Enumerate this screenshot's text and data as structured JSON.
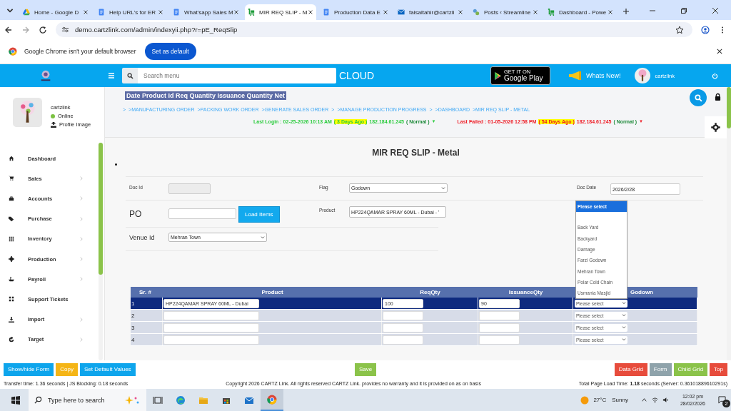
{
  "browser": {
    "tabs": [
      {
        "title": "Home - Google D",
        "selected": false
      },
      {
        "title": "Help URL's for ER",
        "selected": false
      },
      {
        "title": "What'sapp Sales M",
        "selected": false
      },
      {
        "title": "MIR REQ SLIP - M",
        "selected": true
      },
      {
        "title": "Production Data E",
        "selected": false
      },
      {
        "title": "faisaltahir@cartzli",
        "selected": false
      },
      {
        "title": "Posts ‹ Streamline",
        "selected": false
      },
      {
        "title": "Dashboard - Powe",
        "selected": false
      }
    ],
    "url": "demo.cartzlink.com/admin/indexyii.php?r=pE_ReqSlip",
    "infobar": {
      "message": "Google Chrome isn't your default browser",
      "button": "Set as default"
    }
  },
  "header": {
    "search_placeholder": "Search menu",
    "cloud": "CLOUD",
    "play_small": "GET IT ON",
    "play_big": "Google Play",
    "whats_new": "Whats New!",
    "user": "cartzlink"
  },
  "profile": {
    "name": "cartzlink",
    "status": "Online",
    "upload": "Profile Image"
  },
  "sidebar": {
    "items": [
      {
        "label": "Dashboard",
        "has_children": false
      },
      {
        "label": "Sales",
        "has_children": true
      },
      {
        "label": "Accounts",
        "has_children": true
      },
      {
        "label": "Purchase",
        "has_children": true
      },
      {
        "label": "Inventory",
        "has_children": true
      },
      {
        "label": "Production",
        "has_children": true
      },
      {
        "label": "Payroll",
        "has_children": true
      },
      {
        "label": "Support Tickets",
        "has_children": false
      },
      {
        "label": "Import",
        "has_children": true
      },
      {
        "label": "Target",
        "has_children": true
      }
    ]
  },
  "page": {
    "tooltip": "Date Product Id Req Quantity Issuance Quantity Net",
    "breadcrumbs": [
      ">",
      ">MANUFACTURING ORDER",
      ">PACKING WORK ORDER",
      ">GENERATE SALES ORDER",
      ">",
      ">MANAGE PRODUCTION PROGRESS",
      ">",
      ">DASHBOARD",
      ">MIR REQ SLIP - METAL"
    ],
    "logins": [
      {
        "color": "#2ecc40",
        "segments": [
          {
            "kind": "text",
            "text": "Last Login : 02-25-2026 10:13 AM"
          },
          {
            "kind": "highlight",
            "text": "( 3 Days Ago )"
          },
          {
            "kind": "text",
            "text": "182.184.61.245"
          },
          {
            "kind": "status",
            "text": "( Normal )"
          },
          {
            "kind": "arrow",
            "text": "▼"
          }
        ]
      },
      {
        "color": "#ee1c25",
        "segments": [
          {
            "kind": "text",
            "text": "Last Failed : 01-05-2026 12:58 PM"
          },
          {
            "kind": "highlight",
            "text": "( 54 Days Ago )"
          },
          {
            "kind": "text",
            "text": "182.184.61.245"
          },
          {
            "kind": "status",
            "text": "( Normal )"
          },
          {
            "kind": "arrow",
            "text": "▼"
          }
        ]
      }
    ],
    "form_title": "MIR REQ SLIP - Metal"
  },
  "form": {
    "doc_id_label": "Doc Id",
    "flag_label": "Flag",
    "flag_value": "Godown",
    "doc_date_label": "Doc Date",
    "doc_date": "2026/2/28",
    "po_label": "PO",
    "load_button": "Load Items",
    "product_label": "Product",
    "product_value": "HP224QAMAR SPRAY 60ML - Dubai - '",
    "venue_label": "Venue Id",
    "venue_value": "Mehran Town",
    "godown_menu": [
      {
        "label": "Please select",
        "selected": true
      },
      {
        "label": "Back Yard",
        "selected": false
      },
      {
        "label": "Backyard",
        "selected": false
      },
      {
        "label": "Damage",
        "selected": false
      },
      {
        "label": "Farzi Godown",
        "selected": false
      },
      {
        "label": "Mehran Town",
        "selected": false
      },
      {
        "label": "Polar Cold Chain",
        "selected": false
      },
      {
        "label": "Usmania Masjid",
        "selected": false
      }
    ]
  },
  "table": {
    "columns": [
      "Sr. #",
      "Product",
      "ReqQty",
      "IssuanceQty",
      "Godown"
    ],
    "rows": [
      {
        "sr": "1",
        "product": "HP224QAMAR SPRAY 60ML - Dubai",
        "req": "100",
        "issuance": "90",
        "godown": "Please select",
        "selected": true
      },
      {
        "sr": "2",
        "godown": "Please select",
        "selected": false
      },
      {
        "sr": "3",
        "godown": "Please select",
        "selected": false
      },
      {
        "sr": "4",
        "godown": "Please select",
        "selected": false
      }
    ]
  },
  "buttons": {
    "left": [
      {
        "label": "Show/hide Form",
        "color": "#0ea5ec"
      },
      {
        "label": "Copy",
        "color": "#f5b516"
      },
      {
        "label": "Set Default Values",
        "color": "#0ea5ec"
      }
    ],
    "center": [
      {
        "label": "Save",
        "color": "#8bc34a"
      }
    ],
    "right": [
      {
        "label": "Data Grid",
        "color": "#e74c3c"
      },
      {
        "label": "Form",
        "color": "#8fa3ab"
      },
      {
        "label": "Child Grid",
        "color": "#8bc34a"
      },
      {
        "label": "Top",
        "color": "#e74c3c"
      }
    ]
  },
  "status": {
    "transfer": "Transfer time: 1.36 seconds | JS Blocking: 0.18 seconds",
    "copyright": "Copyright 2026 CARTZ Link. All rights reserved CARTZ Link. provides no warranty and it is provided on as on basis",
    "load": "Total Page Load Time: **1.18** seconds (Server: 0.36101889610291s)"
  },
  "taskbar": {
    "search_placeholder": "Type here to search",
    "apps": [
      {
        "active": false
      },
      {
        "active": false
      },
      {
        "active": false
      },
      {
        "active": false
      },
      {
        "active": false
      },
      {
        "active": true
      }
    ],
    "temp": "27°C",
    "weather": "Sunny",
    "time": "12:02 pm",
    "date": "28/02/2026",
    "notifications": "2"
  }
}
